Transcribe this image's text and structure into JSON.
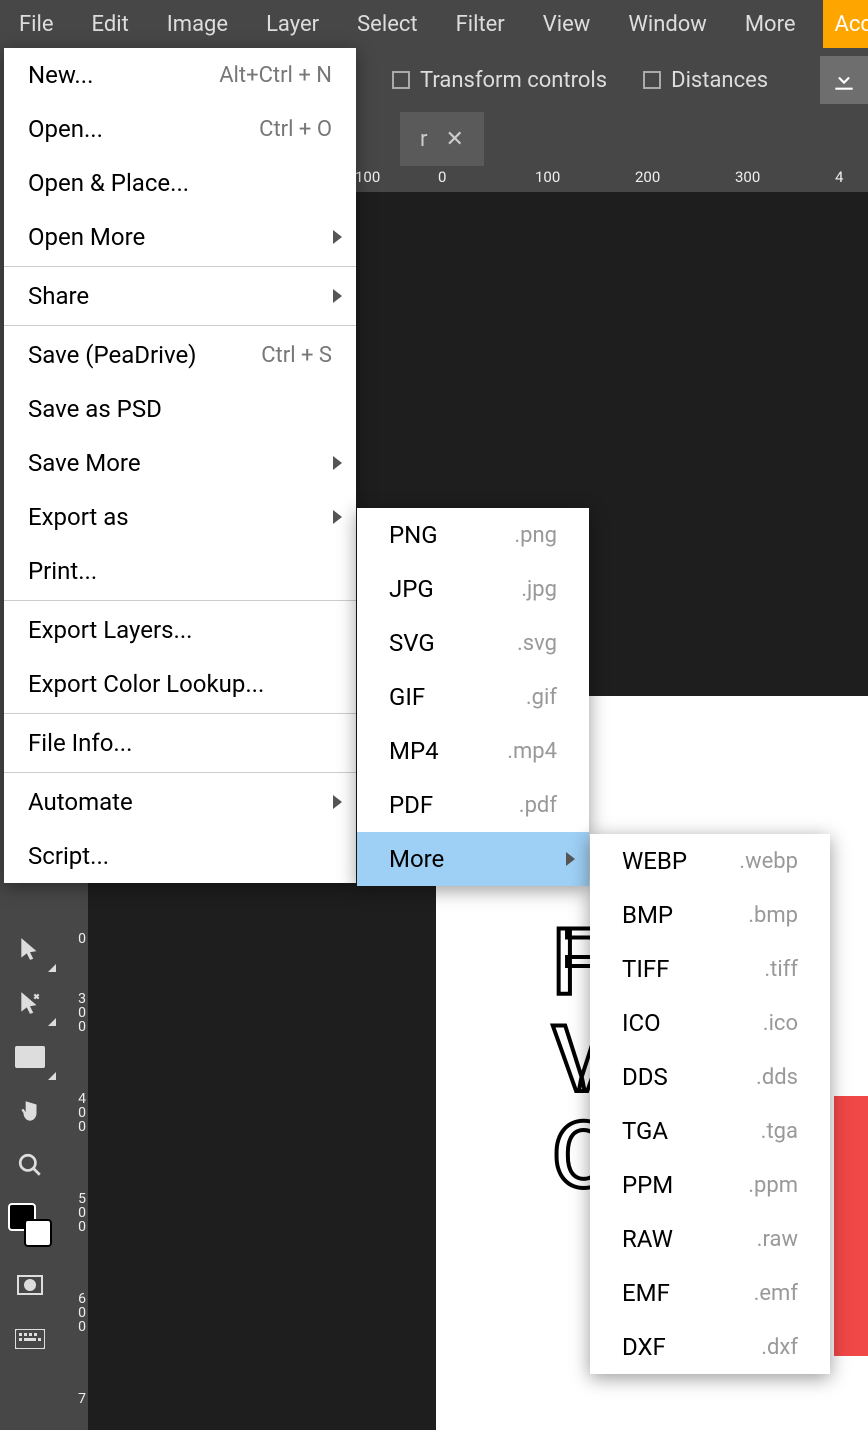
{
  "menubar": {
    "items": [
      "File",
      "Edit",
      "Image",
      "Layer",
      "Select",
      "Filter",
      "View",
      "Window",
      "More"
    ],
    "account": "Acc"
  },
  "options": {
    "transform_label": "Transform controls",
    "distances_label": "Distances"
  },
  "tabstrip": {
    "close_glyph": "✕",
    "tab_tail": "r"
  },
  "ruler": {
    "h_values": [
      "",
      "100",
      "",
      "100",
      "200",
      "300",
      "4"
    ],
    "h_positions": [
      0,
      295,
      375,
      475,
      575,
      675,
      775
    ],
    "v_values": [
      "300",
      "400",
      "500",
      "600",
      "7"
    ],
    "v_positions": [
      992,
      1092,
      1192,
      1292,
      1392
    ]
  },
  "file_menu": [
    {
      "label": "New...",
      "shortcut": "Alt+Ctrl + N"
    },
    {
      "label": "Open...",
      "shortcut": "Ctrl + O"
    },
    {
      "label": "Open & Place..."
    },
    {
      "label": "Open More",
      "submenu": true
    },
    {
      "sep": true
    },
    {
      "label": "Share",
      "submenu": true
    },
    {
      "sep": true
    },
    {
      "label": "Save (PeaDrive)",
      "shortcut": "Ctrl + S"
    },
    {
      "label": "Save as PSD"
    },
    {
      "label": "Save More",
      "submenu": true
    },
    {
      "label": "Export as",
      "submenu": true
    },
    {
      "label": "Print..."
    },
    {
      "sep": true
    },
    {
      "label": "Export Layers..."
    },
    {
      "label": "Export Color Lookup..."
    },
    {
      "sep": true
    },
    {
      "label": "File Info..."
    },
    {
      "sep": true
    },
    {
      "label": "Automate",
      "submenu": true
    },
    {
      "label": "Script..."
    }
  ],
  "export_menu": [
    {
      "label": "PNG",
      "ext": ".png"
    },
    {
      "label": "JPG",
      "ext": ".jpg"
    },
    {
      "label": "SVG",
      "ext": ".svg"
    },
    {
      "label": "GIF",
      "ext": ".gif"
    },
    {
      "label": "MP4",
      "ext": ".mp4"
    },
    {
      "label": "PDF",
      "ext": ".pdf"
    },
    {
      "label": "More",
      "submenu": true,
      "hover": true
    }
  ],
  "more_menu": [
    {
      "label": "WEBP",
      "ext": ".webp"
    },
    {
      "label": "BMP",
      "ext": ".bmp"
    },
    {
      "label": "TIFF",
      "ext": ".tiff"
    },
    {
      "label": "ICO",
      "ext": ".ico"
    },
    {
      "label": "DDS",
      "ext": ".dds"
    },
    {
      "label": "TGA",
      "ext": ".tga"
    },
    {
      "label": "PPM",
      "ext": ".ppm"
    },
    {
      "label": "RAW",
      "ext": ".raw"
    },
    {
      "label": "EMF",
      "ext": ".emf"
    },
    {
      "label": "DXF",
      "ext": ".dxf"
    }
  ],
  "toolbox": {
    "tools": [
      {
        "name": "arrow-tool-icon"
      },
      {
        "name": "arrow-x-tool-icon"
      },
      {
        "name": "rect-tool-icon"
      },
      {
        "name": "hand-tool-icon"
      },
      {
        "name": "zoom-tool-icon"
      },
      {
        "name": "color-swatch-icon"
      },
      {
        "name": "quickmask-icon"
      },
      {
        "name": "keyboard-icon"
      }
    ]
  },
  "paper": {
    "line1": "F",
    "line2": "V",
    "line3": "O"
  }
}
